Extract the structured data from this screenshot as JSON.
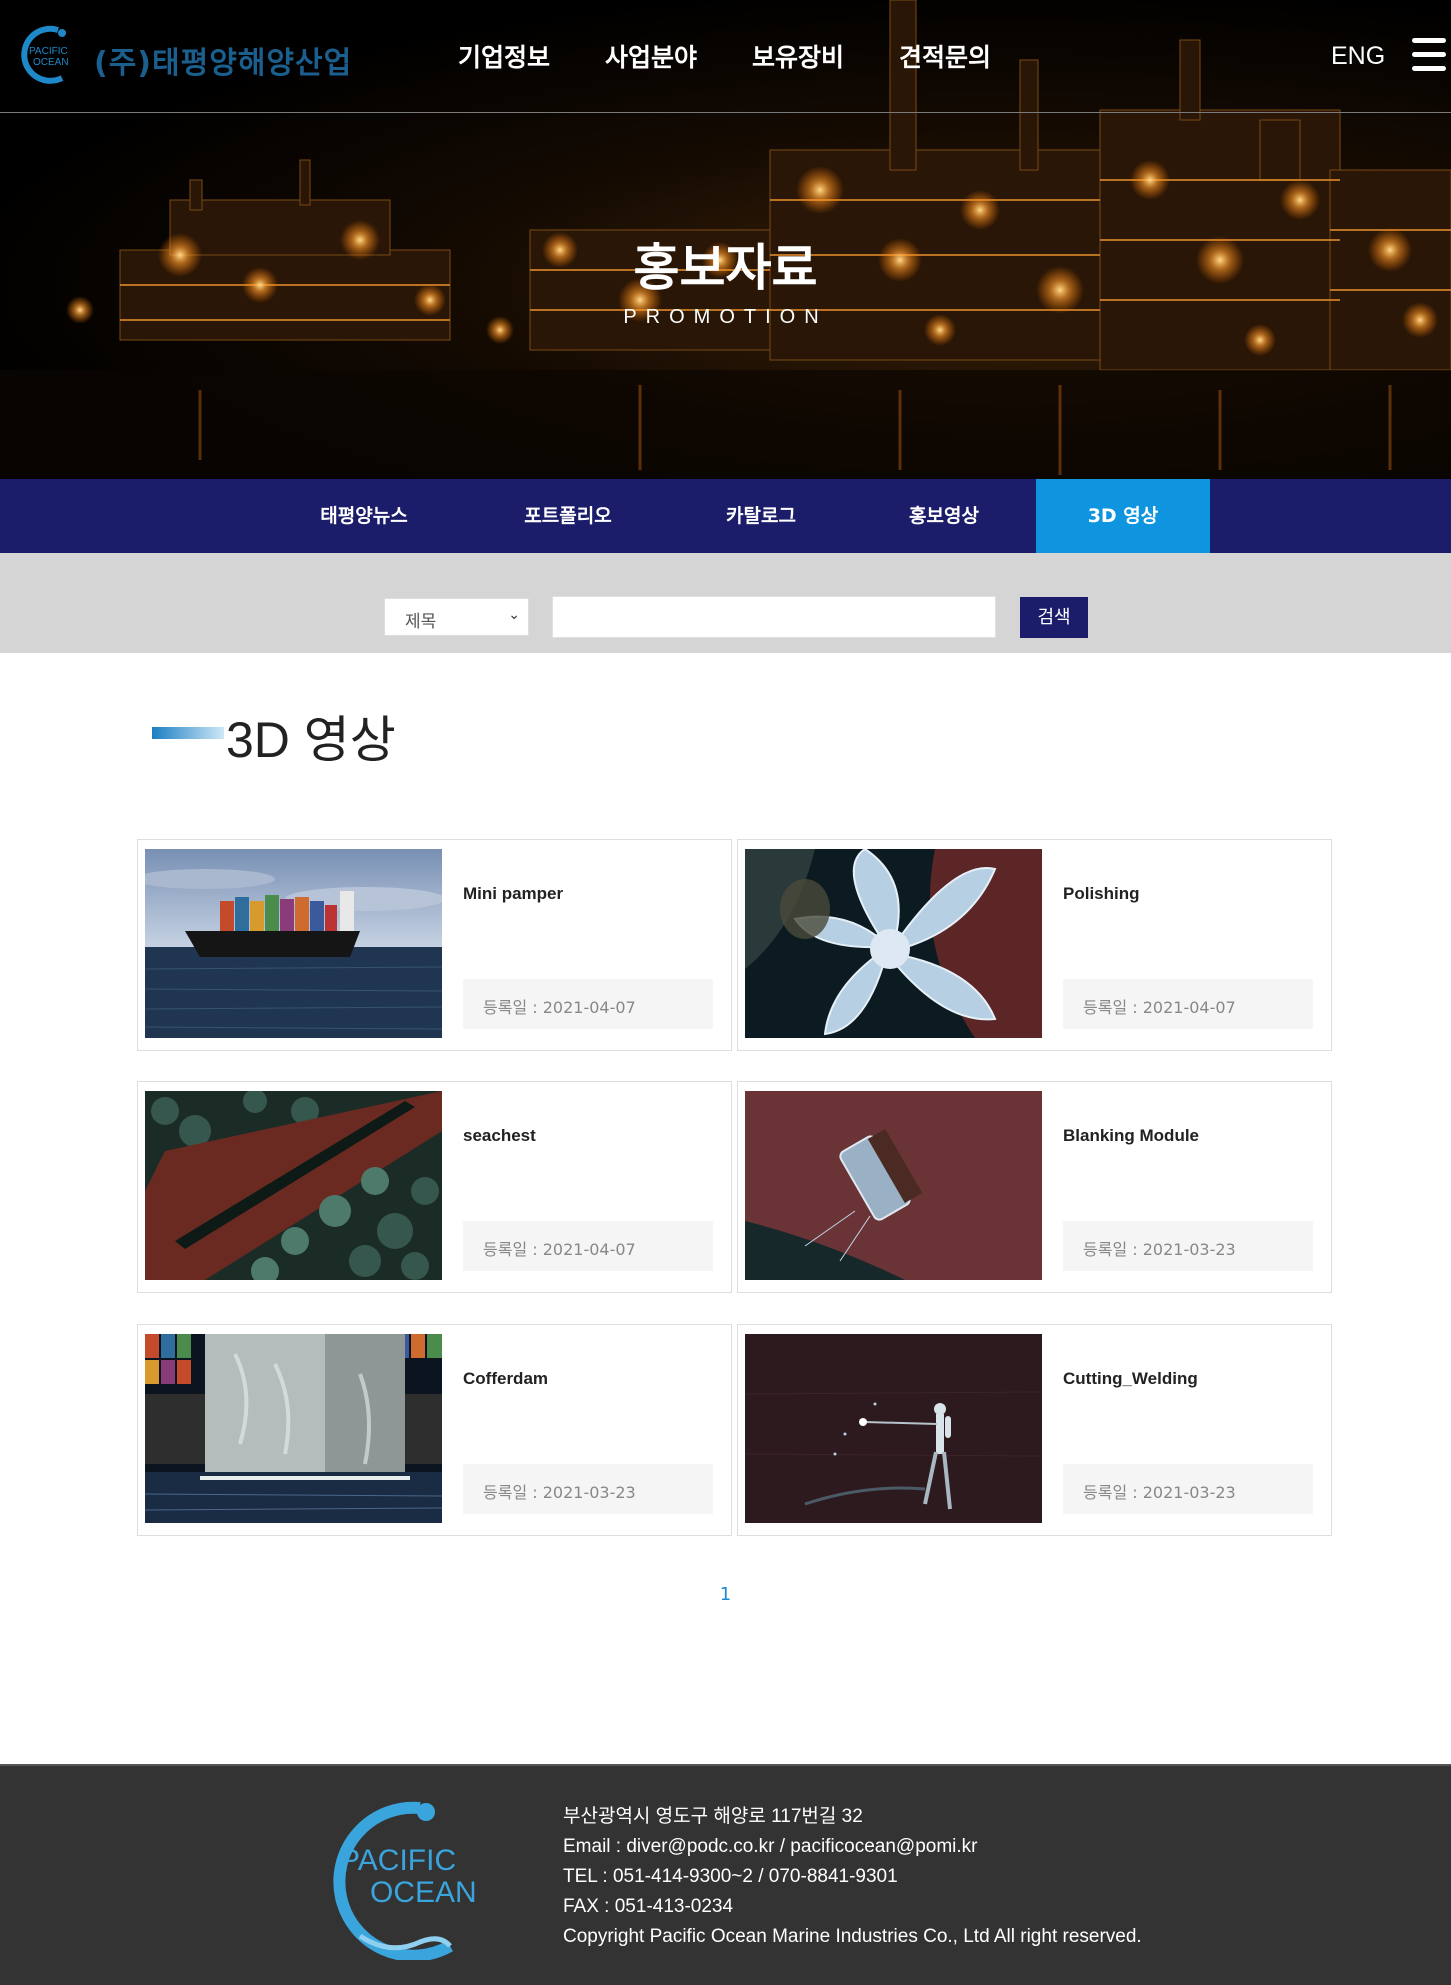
{
  "header": {
    "logo_text": "(주)태평양해양산업",
    "logo_mark_text": [
      "PACIFIC",
      "OCEAN"
    ],
    "nav": [
      "기업정보",
      "사업분야",
      "보유장비",
      "견적문의"
    ],
    "lang": "ENG"
  },
  "hero": {
    "title": "홍보자료",
    "subtitle": "PROMOTION"
  },
  "subnav": {
    "items": [
      "태평양뉴스",
      "포트폴리오",
      "카탈로그",
      "홍보영상",
      "3D 영상"
    ],
    "active": "3D 영상"
  },
  "search": {
    "field_selected": "제목",
    "query": "",
    "button_label": "검색"
  },
  "section": {
    "title": "3D 영상"
  },
  "videos": [
    {
      "title": "Mini pamper",
      "date": "등록일 : 2021-04-07",
      "thumb": "container-ship-at-sea"
    },
    {
      "title": "Polishing",
      "date": "등록일 : 2021-04-07",
      "thumb": "propeller-with-diver"
    },
    {
      "title": "seachest",
      "date": "등록일 : 2021-04-07",
      "thumb": "seachest-grate"
    },
    {
      "title": "Blanking Module",
      "date": "등록일 : 2021-03-23",
      "thumb": "blanking-module-on-hull"
    },
    {
      "title": "Cofferdam",
      "date": "등록일 : 2021-03-23",
      "thumb": "cofferdam-box-at-sea"
    },
    {
      "title": "Cutting_Welding",
      "date": "등록일 : 2021-03-23",
      "thumb": "diver-cutting-welding"
    }
  ],
  "pagination": {
    "current": "1"
  },
  "footer": {
    "logo_text": [
      "PACIFIC",
      "OCEAN"
    ],
    "address": "부산광역시 영도구 해양로 117번길 32",
    "email": "Email : diver@podc.co.kr / pacificocean@pomi.kr",
    "tel": "TEL : 051-414-9300~2 / 070-8841-9301",
    "fax": "FAX : 051-413-0234",
    "copyright": "Copyright Pacific Ocean Marine Industries Co., Ltd All right reserved."
  },
  "colors": {
    "subnav_bg": "#1c1d6a",
    "subnav_active": "#0f95df",
    "search_bg": "#d5d5d5",
    "footer_bg": "#333333",
    "pager_link": "#1a8bd4"
  }
}
